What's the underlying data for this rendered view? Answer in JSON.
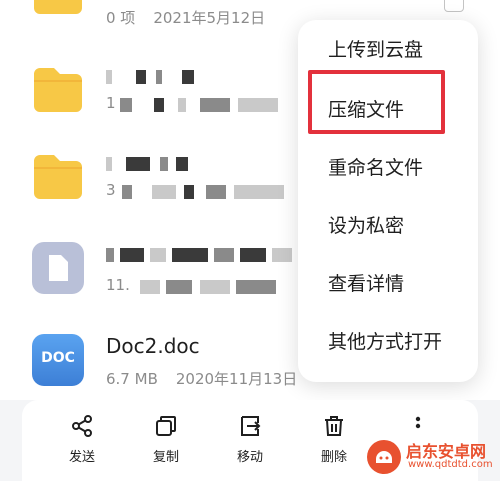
{
  "files": [
    {
      "name": "",
      "item_count": "0 项",
      "date": "2021年5月12日",
      "type": "folder"
    },
    {
      "name": "",
      "meta_prefix": "1",
      "type": "folder"
    },
    {
      "name": "",
      "meta_prefix": "3",
      "type": "folder"
    },
    {
      "name": "",
      "meta_prefix": "11.",
      "type": "file"
    },
    {
      "name": "Doc2.doc",
      "size": "6.7 MB",
      "date": "2020年11月13日",
      "type": "doc",
      "badge": "DOC"
    }
  ],
  "context_menu": {
    "items": [
      "上传到云盘",
      "压缩文件",
      "重命名文件",
      "设为私密",
      "查看详情",
      "其他方式打开"
    ],
    "highlighted": "压缩文件"
  },
  "toolbar": {
    "share": "发送",
    "copy": "复制",
    "move": "移动",
    "delete": "删除"
  },
  "watermark": {
    "name": "启东安卓网",
    "url": "www.qdtdtd.com"
  },
  "colors": {
    "folder": "#f7c846",
    "highlight_box": "#e3313c",
    "doc_icon": "#4a90e2",
    "file_icon": "#b9c0d8"
  }
}
